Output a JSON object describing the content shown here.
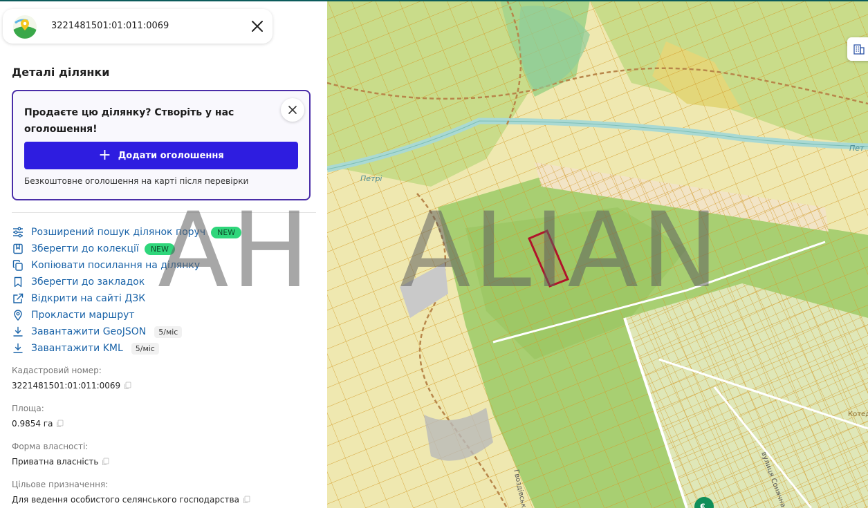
{
  "search": {
    "value": "3221481501:01:011:0069"
  },
  "details": {
    "title": "Деталі ділянки"
  },
  "promo": {
    "title": "Продаєте цю ділянку? Створіть у нас оголошення!",
    "button_label": "Додати оголошення",
    "note": "Безкоштовне оголошення на карті після перевірки"
  },
  "actions": [
    {
      "label": "Розширений пошук ділянок поруч",
      "badge": "NEW",
      "icon": "sliders-icon"
    },
    {
      "label": "Зберегти до колекції",
      "badge": "NEW",
      "icon": "collection-icon"
    },
    {
      "label": "Копіювати посилання на ділянку",
      "icon": "copy-link-icon"
    },
    {
      "label": "Зберегти до закладок",
      "icon": "bookmark-icon"
    },
    {
      "label": "Відкрити на сайті ДЗК",
      "icon": "external-link-icon"
    },
    {
      "label": "Прокласти маршрут",
      "icon": "location-pin-icon"
    },
    {
      "label": "Завантажити GeoJSON",
      "limit": "5/міс",
      "icon": "download-icon"
    },
    {
      "label": "Завантажити KML",
      "limit": "5/міс",
      "icon": "download-icon"
    }
  ],
  "fields": [
    {
      "label": "Кадастровий номер:",
      "value": "3221481501:01:011:0069"
    },
    {
      "label": "Площа:",
      "value": "0.9854 га"
    },
    {
      "label": "Форма власності:",
      "value": "Приватна власність"
    },
    {
      "label": "Цільове призначення:",
      "value": "Для ведення особистого селянського господарства"
    }
  ],
  "watermark": {
    "left_text": "АН",
    "right_text": "ALIAN"
  },
  "map": {
    "labels": {
      "river_left": "Петрі",
      "river_right": "Пет",
      "street_bottom": "Гвоздівська",
      "street_right": "вулиця Сонячна",
      "area_right": "Котедж містеч QP",
      "marker": "є"
    },
    "colors": {
      "field_light": "#efe8b0",
      "field_green": "#c9dc8a",
      "forest": "#9ecb6a",
      "parcel_line": "#d39b2a",
      "river": "#a9d9d3",
      "selected_parcel": "#b0132a"
    }
  },
  "colors": {
    "accent": "#2e1de0",
    "promo_border": "#4a2da8",
    "link": "#1a63a8",
    "badge_new": "#2fd67b"
  }
}
